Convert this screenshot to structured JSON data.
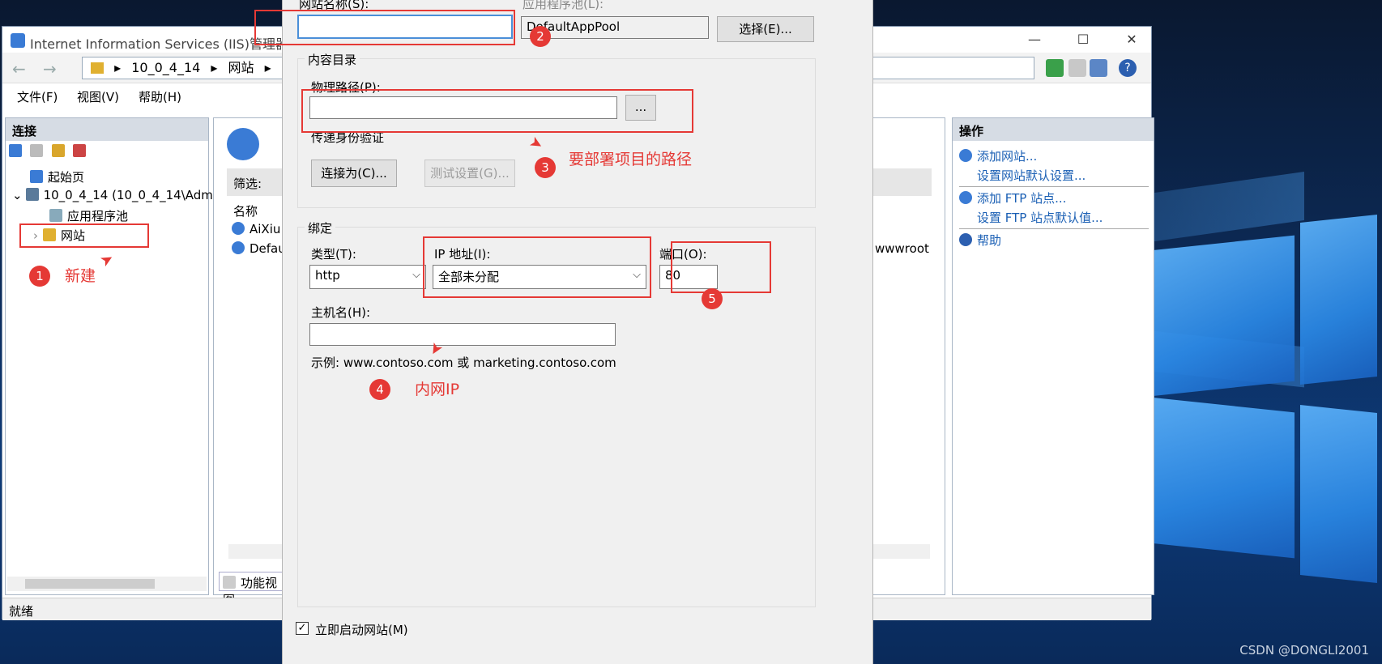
{
  "iis_window": {
    "title": "Internet Information Services (IIS)管理器",
    "address": {
      "segments": [
        "10_0_4_14",
        "网站"
      ]
    },
    "menu": [
      "文件(F)",
      "视图(V)",
      "帮助(H)"
    ],
    "connections": {
      "header": "连接",
      "tree": [
        {
          "label": "起始页"
        },
        {
          "label": "10_0_4_14 (10_0_4_14\\Adm"
        },
        {
          "label": "应用程序池"
        },
        {
          "label": "网站"
        }
      ]
    },
    "center": {
      "filter_label": "筛选:",
      "column_name": "名称",
      "sites": [
        "AiXiu",
        "Defau"
      ],
      "path_fragment": "wwwroot",
      "feature_view_tab": "功能视图"
    },
    "actions": {
      "header": "操作",
      "items": [
        "添加网站...",
        "设置网站默认设置...",
        "添加 FTP 站点...",
        "设置 FTP 站点默认值...",
        "帮助"
      ]
    },
    "status": "就绪"
  },
  "dialog": {
    "site_name_label": "网站名称(S):",
    "site_name_value": "",
    "app_pool_label": "应用程序池(L):",
    "app_pool_value": "DefaultAppPool",
    "select_button": "选择(E)...",
    "content_group": "内容目录",
    "physical_path_label": "物理路径(P):",
    "physical_path_value": "",
    "browse_button": "...",
    "passthrough_label": "传递身份验证",
    "connect_as_button": "连接为(C)...",
    "test_settings_button": "测试设置(G)...",
    "binding_group": "绑定",
    "type_label": "类型(T):",
    "type_value": "http",
    "ip_label": "IP 地址(I):",
    "ip_value": "全部未分配",
    "port_label": "端口(O):",
    "port_value": "80",
    "hostname_label": "主机名(H):",
    "hostname_value": "",
    "example_text": "示例: www.contoso.com 或 marketing.contoso.com",
    "start_immediately_label": "立即启动网站(M)",
    "start_immediately_checked": true
  },
  "annotations": [
    {
      "num": "1",
      "text": "新建"
    },
    {
      "num": "2",
      "text": ""
    },
    {
      "num": "3",
      "text": "要部署项目的路径"
    },
    {
      "num": "4",
      "text": "内网IP"
    },
    {
      "num": "5",
      "text": ""
    }
  ],
  "colors": {
    "annotation": "#e53935",
    "link": "#1a5fb4",
    "desktop_blue": "#2b8ae8"
  },
  "watermark": "CSDN @DONGLI2001"
}
